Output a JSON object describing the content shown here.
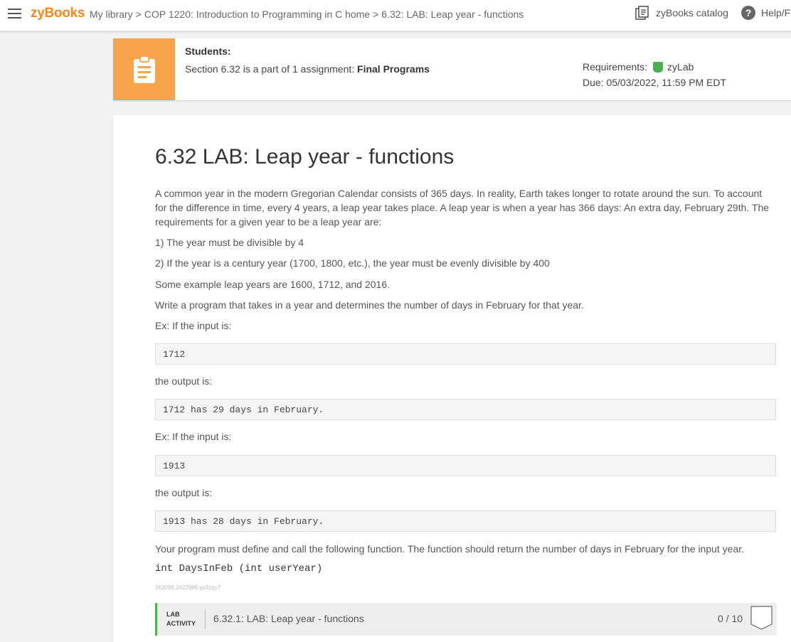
{
  "header": {
    "logo": "zyBooks",
    "breadcrumb": [
      "My library",
      "COP 1220: Introduction to Programming in C home",
      "6.32: LAB: Leap year - functions"
    ],
    "breadcrumb_sep": ">",
    "catalog_label": "zyBooks catalog",
    "help_label": "Help/F"
  },
  "banner": {
    "students_label": "Students:",
    "section_prefix": "Section 6.32 is a part of 1 assignment: ",
    "assignment_name": "Final Programs",
    "requirements_label": "Requirements:",
    "requirement_type": "zyLab",
    "due": "Due: 05/03/2022, 11:59 PM EDT"
  },
  "main": {
    "title": "6.32 LAB: Leap year - functions",
    "intro": "A common year in the modern Gregorian Calendar consists of 365 days. In reality, Earth takes longer to rotate around the sun. To account for the difference in time, every 4 years, a leap year takes place. A leap year is when a year has 366 days: An extra day, February 29th. The requirements for a given year to be a leap year are:",
    "rule1": "1) The year must be divisible by 4",
    "rule2": "2) If the year is a century year (1700, 1800, etc.), the year must be evenly divisible by 400",
    "examples_text": "Some example leap years are 1600, 1712, and 2016.",
    "task_text": "Write a program that takes in a year and determines the number of days in February for that year.",
    "ex_input_label": "Ex: If the input is:",
    "output_label": "the output is:",
    "example1_input": "1712",
    "example1_output": "1712 has 29 days in February.",
    "example2_input": "1913",
    "example2_output": "1913 has 28 days in February.",
    "function_text": "Your program must define and call the following function. The function should return the number of days in February for the input year.",
    "function_signature": "int DaysInFeb (int userYear)",
    "resource_id": "363096.2422986.qx3zqy7"
  },
  "lab_activity": {
    "tag_line1": "LAB",
    "tag_line2": "ACTIVITY",
    "title": "6.32.1: LAB: Leap year - functions",
    "score": "0 / 10"
  },
  "colors": {
    "brand_orange": "#f5871f",
    "banner_icon_bg": "#f8a44a",
    "zylab_green": "#4caf50"
  }
}
